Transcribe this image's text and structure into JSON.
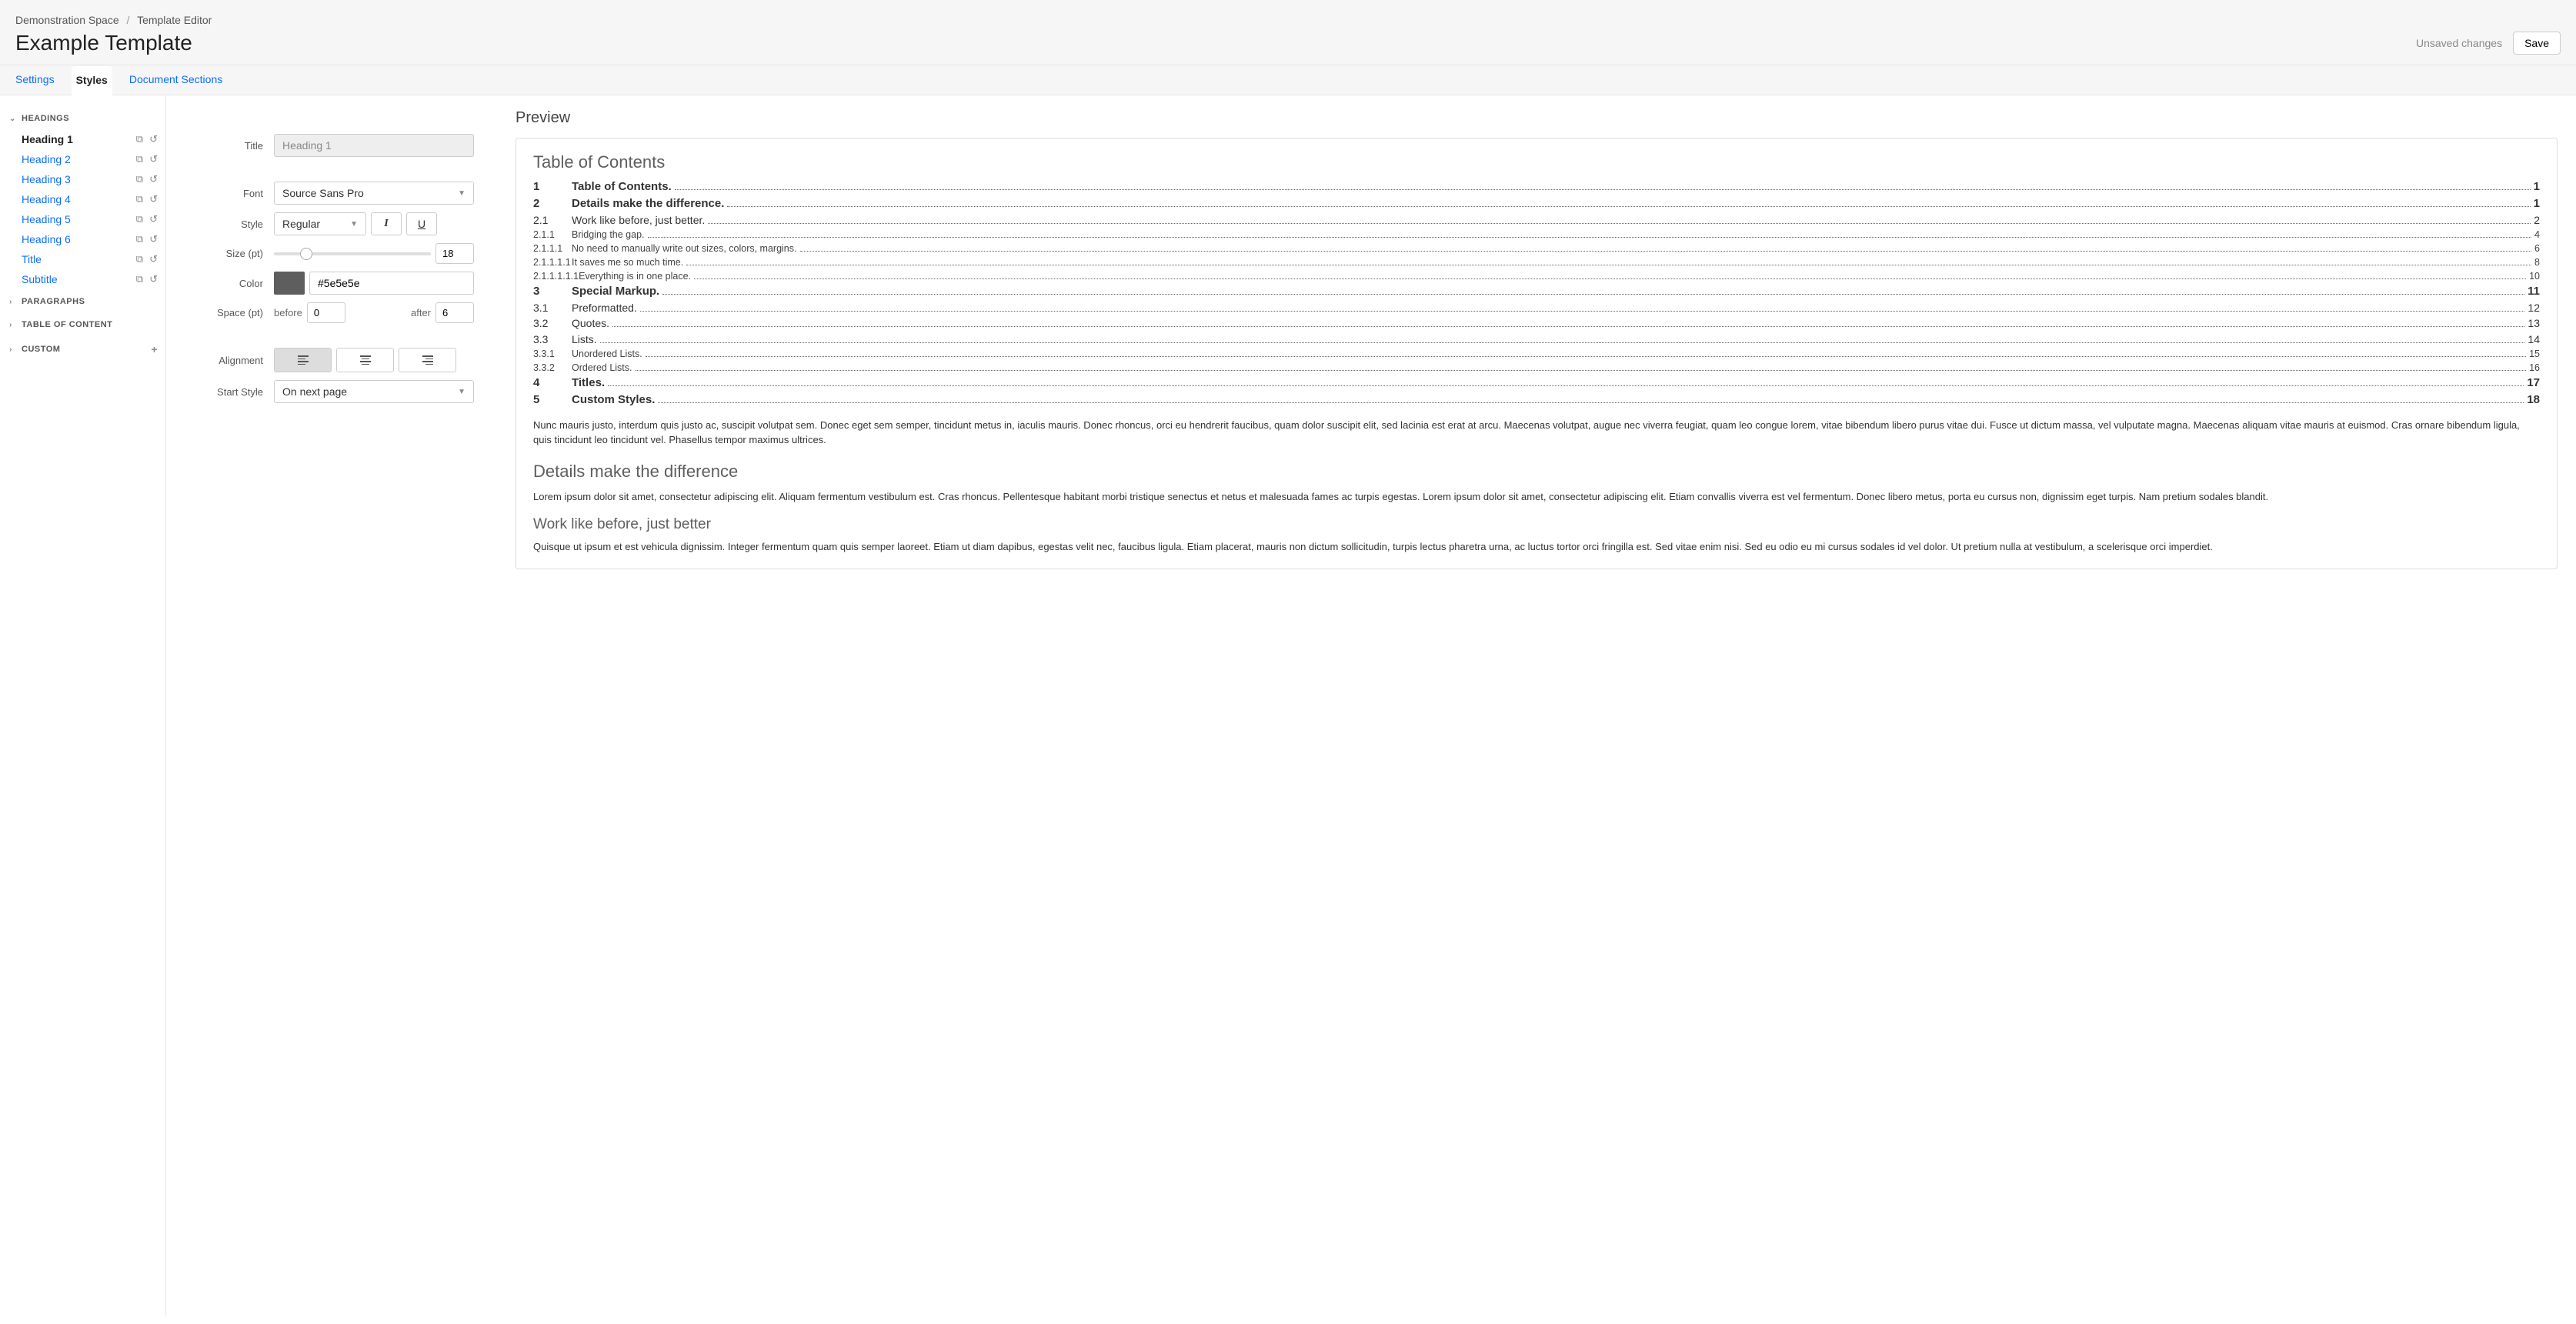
{
  "breadcrumb": {
    "space": "Demonstration Space",
    "section": "Template Editor"
  },
  "page_title": "Example Template",
  "status": "Unsaved changes",
  "save_label": "Save",
  "tabs": [
    "Settings",
    "Styles",
    "Document Sections"
  ],
  "active_tab": 1,
  "sidebar": {
    "groups": [
      {
        "label": "HEADINGS",
        "expanded": true,
        "items": [
          {
            "label": "Heading 1",
            "active": true
          },
          {
            "label": "Heading 2"
          },
          {
            "label": "Heading 3"
          },
          {
            "label": "Heading 4"
          },
          {
            "label": "Heading 5"
          },
          {
            "label": "Heading 6"
          },
          {
            "label": "Title"
          },
          {
            "label": "Subtitle"
          }
        ]
      },
      {
        "label": "PARAGRAPHS",
        "expanded": false
      },
      {
        "label": "TABLE OF CONTENT",
        "expanded": false
      },
      {
        "label": "CUSTOM",
        "expanded": false,
        "add": true
      }
    ]
  },
  "form": {
    "title_label": "Title",
    "title_value": "Heading 1",
    "font_label": "Font",
    "font_value": "Source Sans Pro",
    "style_label": "Style",
    "style_value": "Regular",
    "size_label": "Size (pt)",
    "size_value": "18",
    "color_label": "Color",
    "color_value": "#5e5e5e",
    "space_label": "Space (pt)",
    "space_before_label": "before",
    "space_before_value": "0",
    "space_after_label": "after",
    "space_after_value": "6",
    "alignment_label": "Alignment",
    "start_label": "Start Style",
    "start_value": "On next page"
  },
  "preview": {
    "heading": "Preview",
    "toc_title": "Table of Contents",
    "toc": [
      {
        "num": "1",
        "text": "Table of Contents.",
        "page": "1",
        "level": 0
      },
      {
        "num": "2",
        "text": "Details make the difference.",
        "page": "1",
        "level": 0
      },
      {
        "num": "2.1",
        "text": "Work like before, just better.",
        "page": "2",
        "level": 1
      },
      {
        "num": "2.1.1",
        "text": "Bridging the gap.",
        "page": "4",
        "level": 2
      },
      {
        "num": "2.1.1.1",
        "text": "No need to manually write out sizes, colors, margins.",
        "page": "6",
        "level": 3
      },
      {
        "num": "2.1.1.1.1",
        "text": "It saves me so much time.",
        "page": "8",
        "level": 4
      },
      {
        "num": "2.1.1.1.1.1",
        "text": "Everything is in one place.",
        "page": "10",
        "level": 5
      },
      {
        "num": "3",
        "text": "Special Markup.",
        "page": "11",
        "level": 0
      },
      {
        "num": "3.1",
        "text": "Preformatted.",
        "page": "12",
        "level": 1
      },
      {
        "num": "3.2",
        "text": "Quotes.",
        "page": "13",
        "level": 1
      },
      {
        "num": "3.3",
        "text": "Lists.",
        "page": "14",
        "level": 1
      },
      {
        "num": "3.3.1",
        "text": "Unordered Lists.",
        "page": "15",
        "level": 2
      },
      {
        "num": "3.3.2",
        "text": "Ordered Lists.",
        "page": "16",
        "level": 2
      },
      {
        "num": "4",
        "text": "Titles.",
        "page": "17",
        "level": 0
      },
      {
        "num": "5",
        "text": "Custom Styles.",
        "page": "18",
        "level": 0
      }
    ],
    "body1": "Nunc mauris justo, interdum quis justo ac, suscipit volutpat sem. Donec eget sem semper, tincidunt metus in, iaculis mauris. Donec rhoncus, orci eu hendrerit faucibus, quam dolor suscipit elit, sed lacinia est erat at arcu. Maecenas volutpat, augue nec viverra feugiat, quam leo congue lorem, vitae bibendum libero purus vitae dui. Fusce ut dictum massa, vel vulputate magna. Maecenas aliquam vitae mauris at euismod. Cras ornare bibendum ligula, quis tincidunt leo tincidunt vel. Phasellus tempor maximus ultrices.",
    "h2a": "Details make the difference",
    "body2": "Lorem ipsum dolor sit amet, consectetur adipiscing elit. Aliquam fermentum vestibulum est. Cras rhoncus. Pellentesque habitant morbi tristique senectus et netus et malesuada fames ac turpis egestas.  Lorem ipsum dolor sit amet, consectetur adipiscing elit. Etiam convallis viverra est vel fermentum. Donec libero metus, porta eu cursus non, dignissim eget turpis. Nam pretium sodales blandit.",
    "h2b": "Work like before, just better",
    "body3": "Quisque ut ipsum et est vehicula dignissim. Integer fermentum quam quis semper laoreet. Etiam ut diam dapibus, egestas velit nec, faucibus ligula. Etiam placerat, mauris non dictum sollicitudin, turpis lectus pharetra urna, ac luctus tortor orci fringilla est. Sed vitae enim nisi. Sed eu odio eu mi cursus sodales id vel dolor. Ut pretium nulla at vestibulum, a scelerisque orci imperdiet."
  }
}
